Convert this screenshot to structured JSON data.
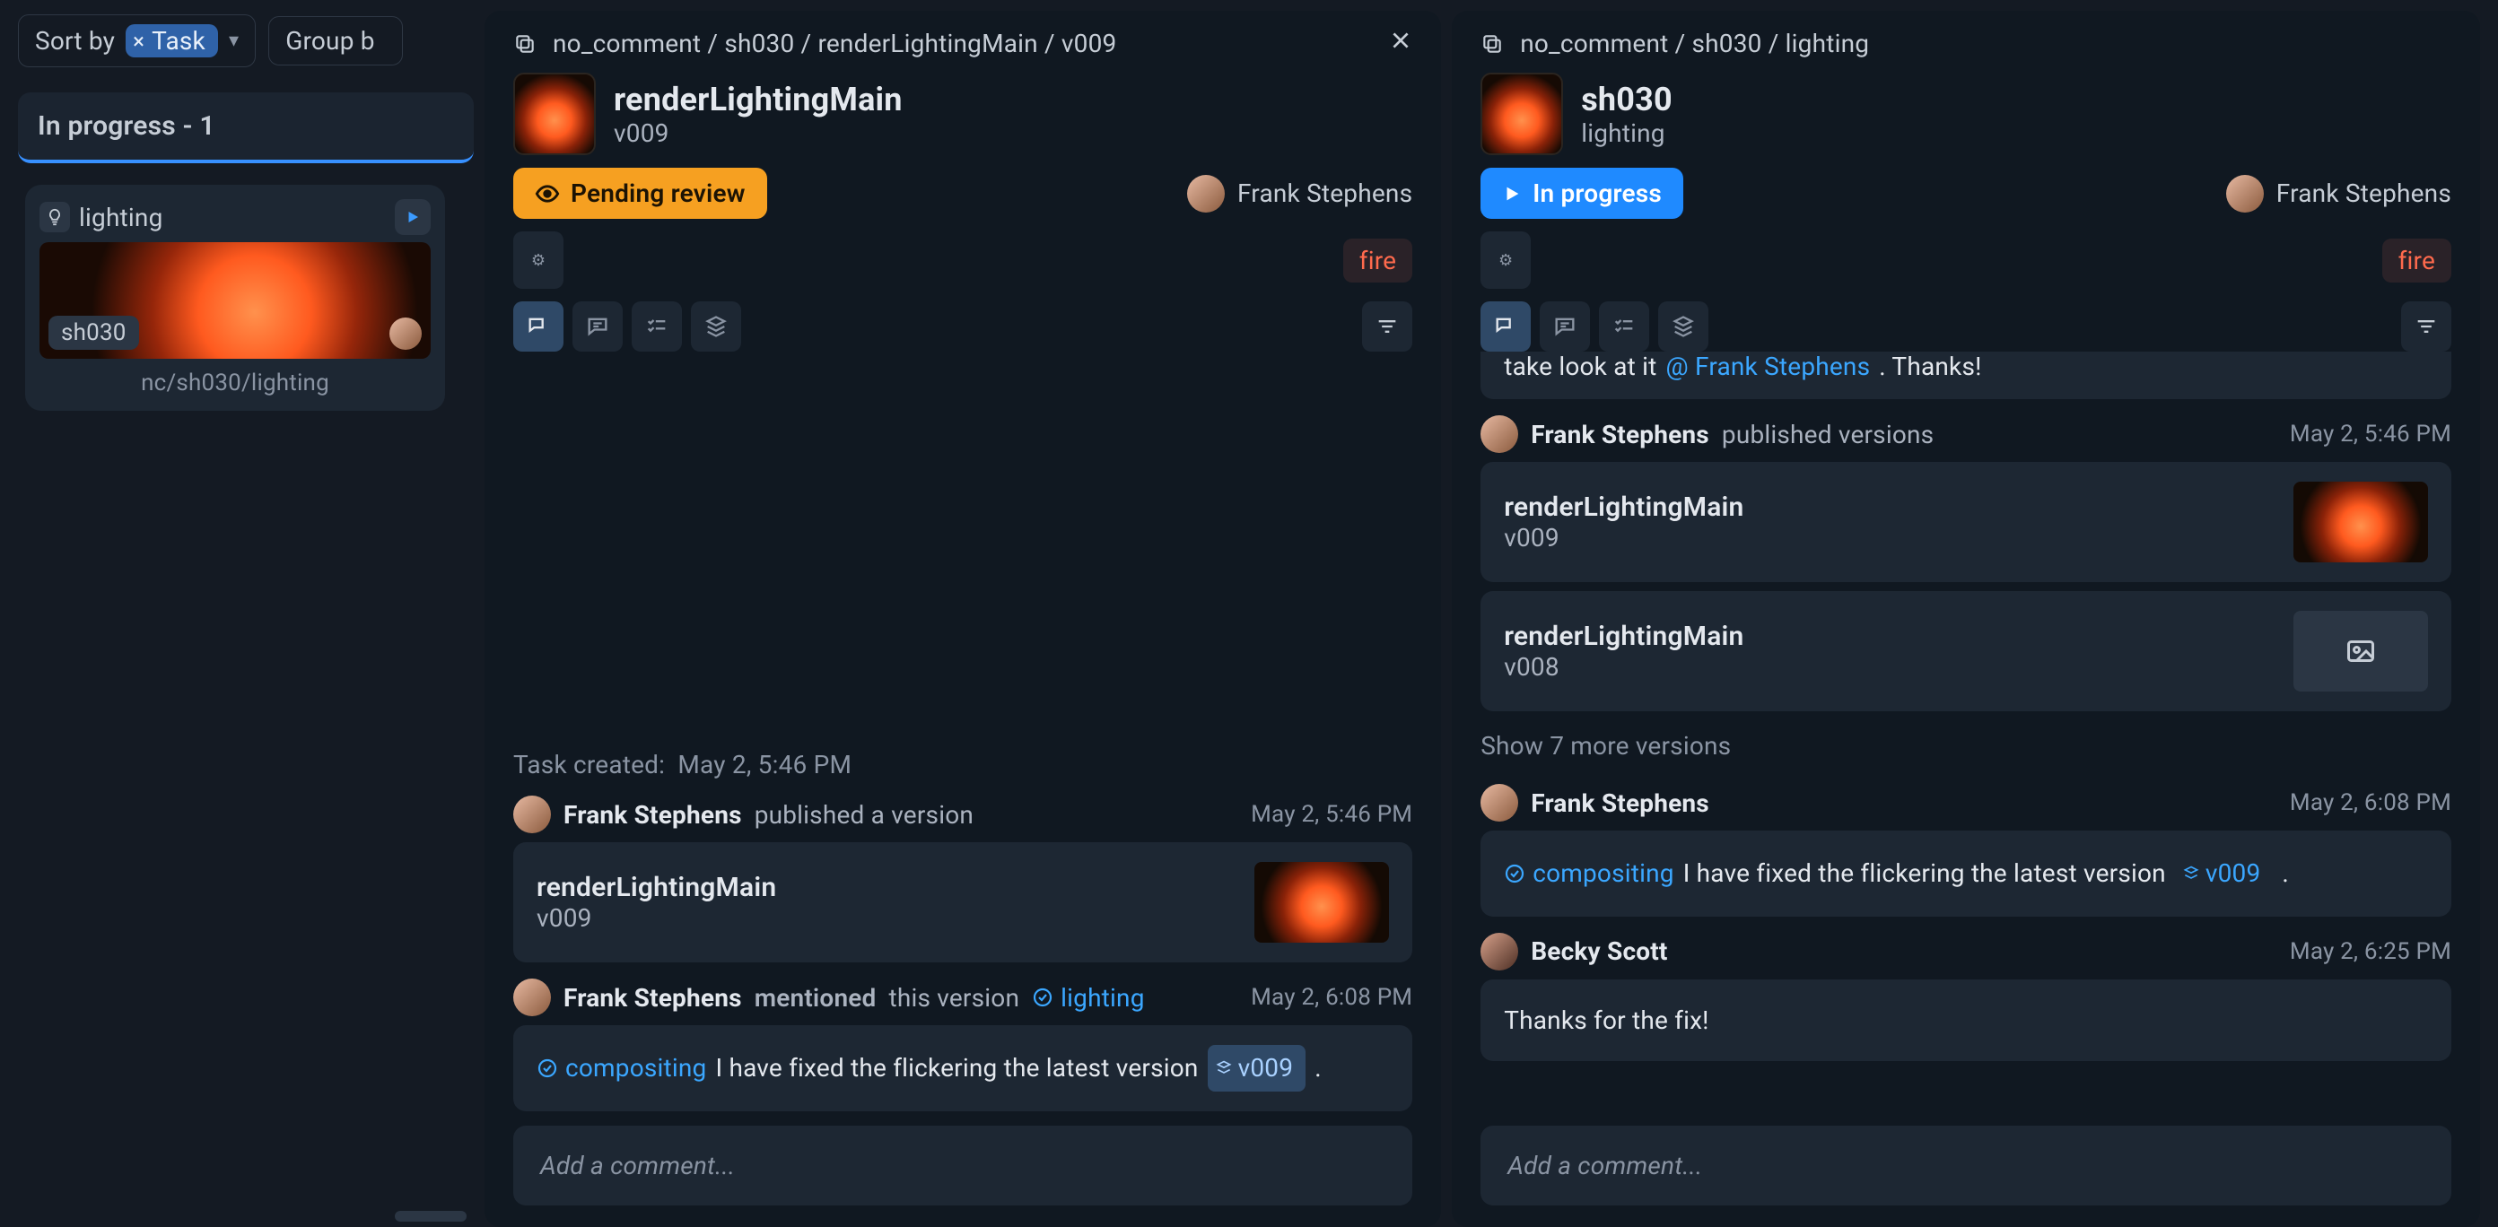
{
  "toolbar": {
    "sort_label": "Sort by",
    "sort_chip_label": "Task",
    "group_label": "Group b"
  },
  "board": {
    "column_header": "In progress - 1",
    "card": {
      "task_label": "lighting",
      "shot_code": "sh030",
      "path": "nc/sh030/lighting"
    }
  },
  "panel_left": {
    "breadcrumb": "no_comment / sh030 / renderLightingMain / v009",
    "title": "renderLightingMain",
    "subtitle": "v009",
    "status_label": "Pending review",
    "assignee": "Frank Stephens",
    "tag": "fire",
    "task_created_label": "Task created:  May 2, 5:46 PM",
    "events": {
      "publish": {
        "user": "Frank Stephens",
        "verb": "published a version",
        "time": "May 2, 5:46 PM",
        "version_name": "renderLightingMain",
        "version_num": "v009"
      },
      "mention": {
        "user": "Frank Stephens",
        "verb": "mentioned",
        "verb2": "this version",
        "task_chip": "lighting",
        "time": "May 2, 6:08 PM",
        "comment_task_chip": "compositing",
        "comment_text": "I have fixed the flickering the latest version",
        "comment_version_chip": "v009",
        "period": "."
      }
    },
    "comment_placeholder": "Add a comment..."
  },
  "panel_right": {
    "breadcrumb": "no_comment / sh030 / lighting",
    "title": "sh030",
    "subtitle": "lighting",
    "status_label": "In progress",
    "assignee": "Frank Stephens",
    "tag": "fire",
    "truncated": {
      "text": "take look at it",
      "mention": "@ Frank Stephens",
      "after": ". Thanks!"
    },
    "events": {
      "publish": {
        "user": "Frank Stephens",
        "verb": "published versions",
        "time": "May 2, 5:46 PM",
        "v1_name": "renderLightingMain",
        "v1_num": "v009",
        "v2_name": "renderLightingMain",
        "v2_num": "v008"
      },
      "show_more": "Show 7 more versions",
      "comment1": {
        "user": "Frank Stephens",
        "time": "May 2, 6:08 PM",
        "task_chip": "compositing",
        "text": "I have fixed the flickering the latest version",
        "version_chip": "v009",
        "period": "."
      },
      "comment2": {
        "user": "Becky Scott",
        "time": "May 2, 6:25 PM",
        "text": "Thanks for the fix!"
      }
    },
    "comment_placeholder": "Add a comment..."
  }
}
